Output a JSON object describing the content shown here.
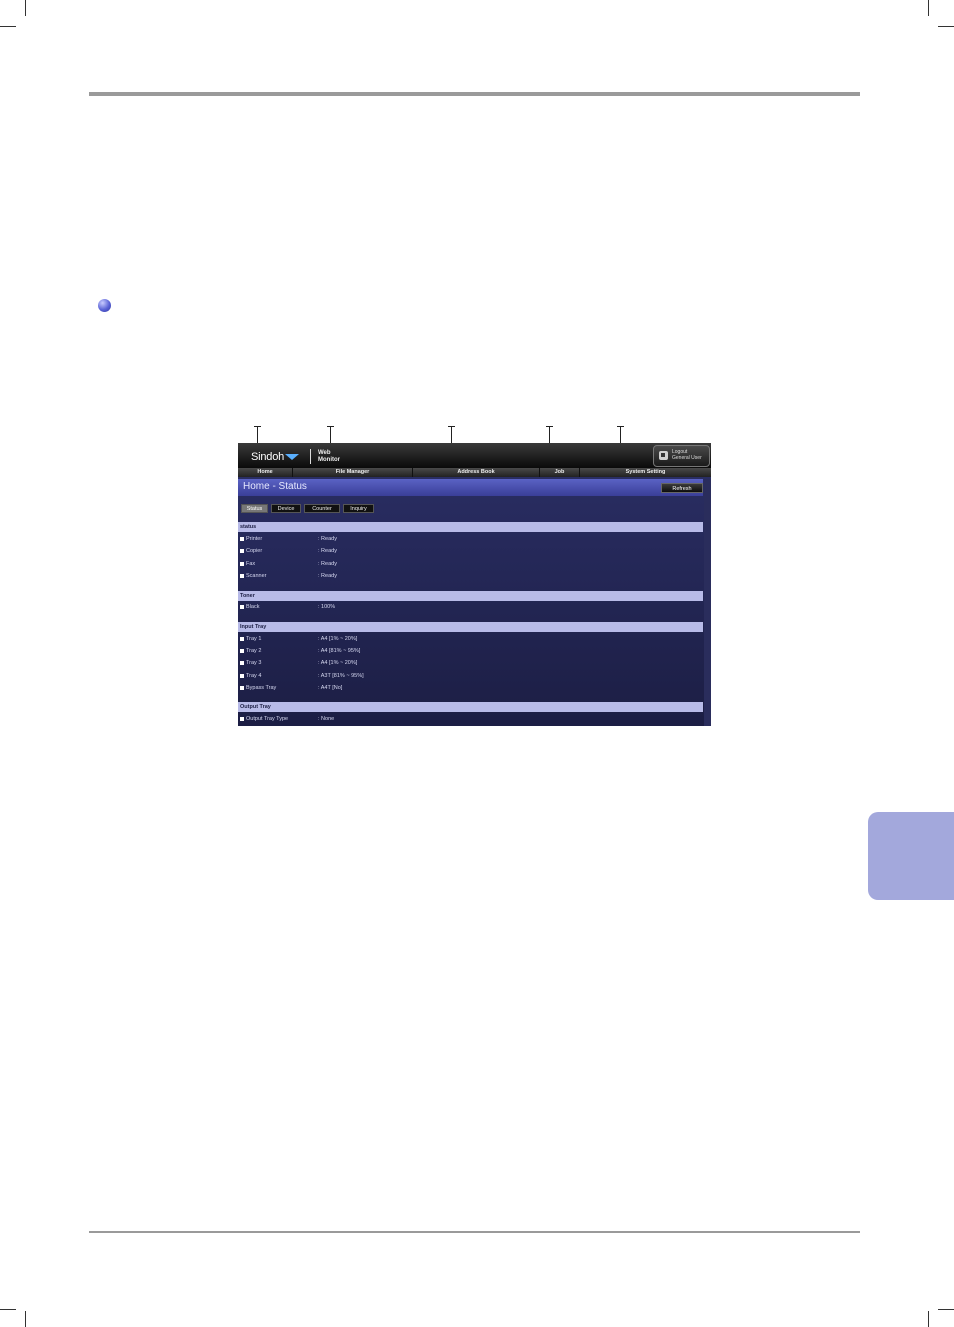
{
  "app": {
    "logo": "Sindoh",
    "logo_sub": "Web Monitor",
    "logout_label": "Logout",
    "logout_user": "General User"
  },
  "nav": [
    "Home",
    "File Manager",
    "Address Book",
    "Job",
    "System Setting"
  ],
  "page_title": "Home - Status",
  "refresh_label": "Refresh",
  "subtabs": [
    "Status",
    "Device",
    "Counter",
    "Inquiry"
  ],
  "sections": {
    "status": {
      "title": "status",
      "rows": [
        {
          "label": "Printer",
          "value": ": Ready"
        },
        {
          "label": "Copier",
          "value": ": Ready"
        },
        {
          "label": "Fax",
          "value": ": Ready"
        },
        {
          "label": "Scanner",
          "value": ": Ready"
        }
      ]
    },
    "toner": {
      "title": "Toner",
      "rows": [
        {
          "label": "Black",
          "value": ": 100%"
        }
      ]
    },
    "input_tray": {
      "title": "Input Tray",
      "rows": [
        {
          "label": "Tray 1",
          "value": ": A4 [1% ~ 20%]"
        },
        {
          "label": "Tray 2",
          "value": ": A4 [81% ~ 95%]"
        },
        {
          "label": "Tray 3",
          "value": ": A4 [1% ~ 20%]"
        },
        {
          "label": "Tray 4",
          "value": ": A3T [81% ~ 95%]"
        },
        {
          "label": "Bypass Tray",
          "value": ": A4T [No]"
        }
      ]
    },
    "output_tray": {
      "title": "Output Tray",
      "rows": [
        {
          "label": "Output Tray Type",
          "value": ": None"
        }
      ]
    }
  }
}
